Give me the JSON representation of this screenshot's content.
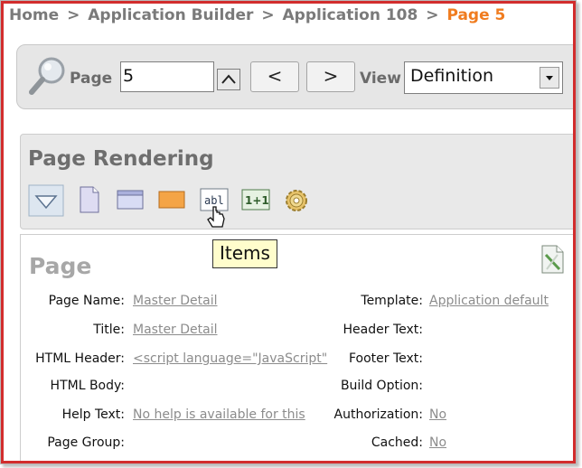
{
  "breadcrumb": {
    "home": "Home",
    "sep": ">",
    "builder": "Application Builder",
    "app": "Application 108",
    "current": "Page 5"
  },
  "toolbar": {
    "page_label": "Page",
    "page_value": "5",
    "prev_label": "<",
    "next_label": ">",
    "view_label": "View",
    "view_selected": "Definition"
  },
  "page_rendering": {
    "title": "Page Rendering",
    "icons": [
      "collapse-triangle-icon",
      "page-icon",
      "region-icon",
      "region-tab-icon",
      "items-icon",
      "computation-icon",
      "process-gear-icon"
    ],
    "tooltip": "Items"
  },
  "page_detail": {
    "title": "Page",
    "left": [
      {
        "label": "Page Name:",
        "value": "Master Detail"
      },
      {
        "label": "Title:",
        "value": "Master Detail"
      },
      {
        "label": "HTML Header:",
        "value": "<script language=\"JavaScript\""
      },
      {
        "label": "HTML Body:",
        "value": ""
      },
      {
        "label": "Help Text:",
        "value": "No help is available for this"
      },
      {
        "label": "Page Group:",
        "value": ""
      }
    ],
    "right": [
      {
        "label": "Template:",
        "value": "Application default"
      },
      {
        "label": "Header Text:",
        "value": ""
      },
      {
        "label": "Footer Text:",
        "value": ""
      },
      {
        "label": "Build Option:",
        "value": ""
      },
      {
        "label": "Authorization:",
        "value": "No"
      },
      {
        "label": "Cached:",
        "value": "No"
      }
    ]
  },
  "colors": {
    "accent_orange": "#f07c1f",
    "frame_red": "#d22d2d",
    "tooltip_bg": "#fffdcc"
  }
}
